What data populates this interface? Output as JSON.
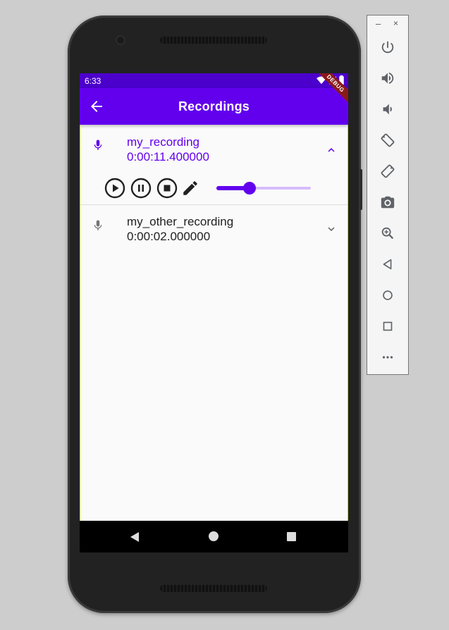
{
  "status": {
    "time": "6:33"
  },
  "app": {
    "title": "Recordings",
    "debug_label": "DEBUG"
  },
  "recordings": [
    {
      "name": "my_recording",
      "duration": "0:00:11.400000",
      "expanded": true
    },
    {
      "name": "my_other_recording",
      "duration": "0:00:02.000000",
      "expanded": false
    }
  ],
  "player": {
    "progress": 0.35
  },
  "colors": {
    "primary": "#6200ee",
    "primary_dark": "#4b00cc",
    "slider_inactive": "#d6bdfc",
    "text": "#212121",
    "icon_grey": "#757575"
  },
  "icons": {
    "back": "arrow-left-icon",
    "mic": "mic-icon",
    "expand_less": "chevron-up-icon",
    "expand_more": "chevron-down-icon",
    "play": "play-circle-icon",
    "pause": "pause-circle-icon",
    "stop": "stop-circle-icon",
    "edit": "pencil-icon"
  },
  "emulator_toolbar": {
    "minimize": "–",
    "close": "×",
    "buttons": [
      "power",
      "volume-up",
      "volume-down",
      "rotate-left",
      "rotate-right",
      "screenshot",
      "zoom",
      "back",
      "home",
      "overview",
      "more"
    ]
  }
}
